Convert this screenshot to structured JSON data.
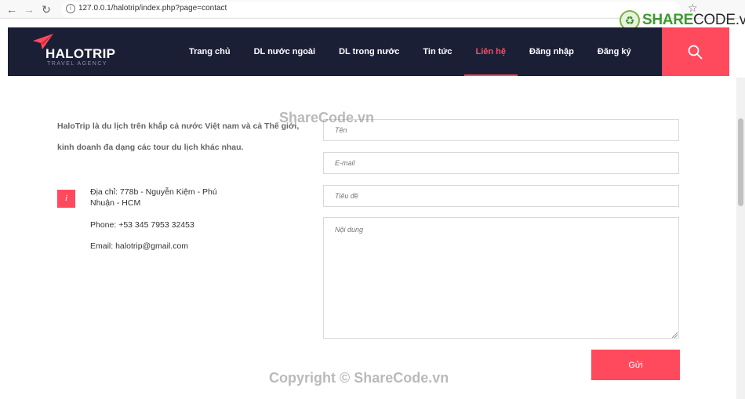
{
  "browser": {
    "url": "127.0.0.1/halotrip/index.php?page=contact"
  },
  "watermark_logo": {
    "text_brand": "SHARE",
    "text_rest": "CODE.vn"
  },
  "site": {
    "logo_title": "HALOTRIP",
    "logo_subtitle": "TRAVEL AGENCY",
    "menu": [
      {
        "label": "Trang chủ",
        "active": false
      },
      {
        "label": "DL nước ngoài",
        "active": false
      },
      {
        "label": "DL trong nước",
        "active": false
      },
      {
        "label": "Tin tức",
        "active": false
      },
      {
        "label": "Liên hệ",
        "active": true
      },
      {
        "label": "Đăng nhập",
        "active": false
      },
      {
        "label": "Đăng ký",
        "active": false
      }
    ],
    "accent_color": "#ff4a5e",
    "header_color": "#1b1f36"
  },
  "contact": {
    "intro": "HaloTrip là du lịch trên khắp cả nước Việt nam và cả Thế giới, kinh doanh đa dạng các tour du lịch khác nhau.",
    "info_icon": "i",
    "address_line1": "Địa chỉ: 778b - Nguyễn Kiệm - Phú",
    "address_line2": "Nhuận - HCM",
    "phone": "Phone: +53 345 7953 32453",
    "email": "Email: halotrip@gmail.com"
  },
  "form": {
    "name_placeholder": "Tên",
    "email_placeholder": "E-mail",
    "subject_placeholder": "Tiêu đề",
    "message_placeholder": "Nội dung",
    "submit_label": "Gửi"
  },
  "watermarks": {
    "top": "ShareCode.vn",
    "bottom": "Copyright © ShareCode.vn"
  }
}
